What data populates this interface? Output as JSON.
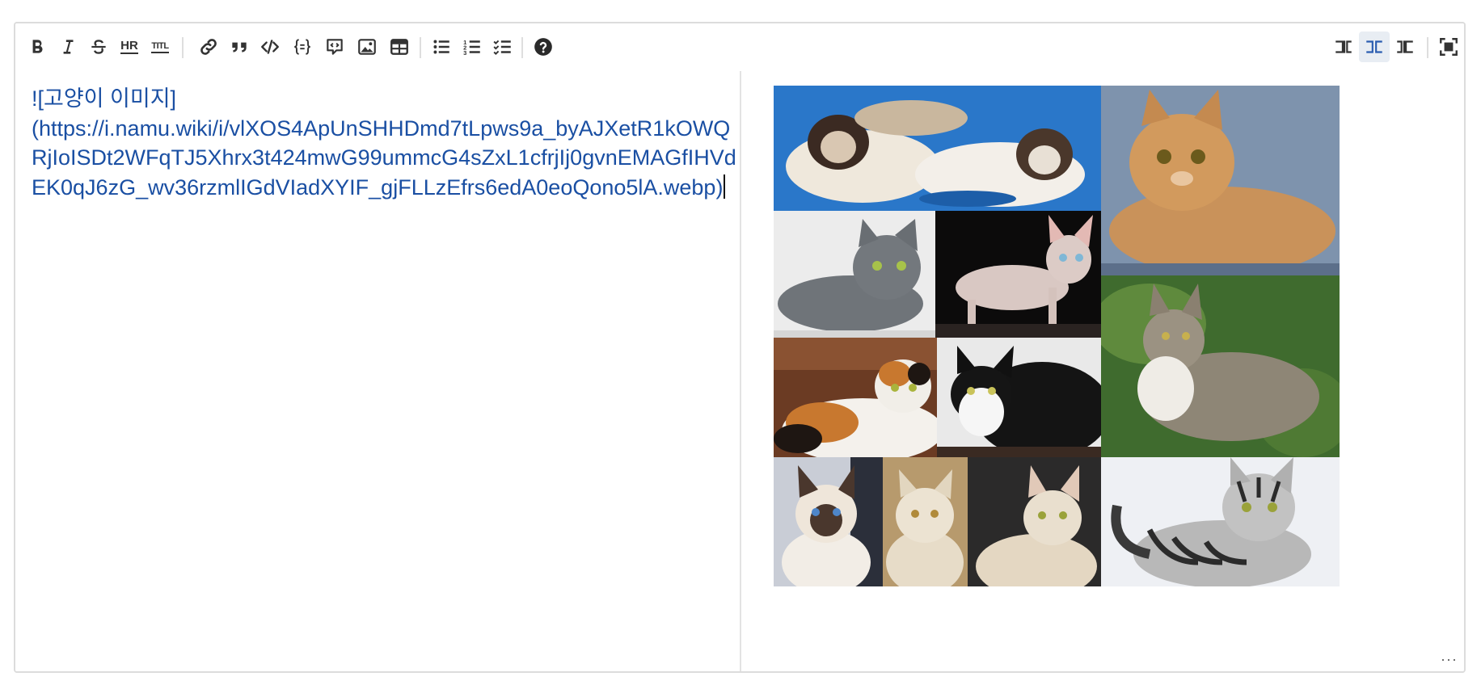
{
  "toolbar": {
    "left_buttons": [
      {
        "name": "bold-icon"
      },
      {
        "name": "italic-icon"
      },
      {
        "name": "strikethrough-icon"
      },
      {
        "name": "horizontal-rule-icon"
      },
      {
        "name": "title-icon"
      },
      {
        "name": "link-icon"
      },
      {
        "name": "quote-icon"
      },
      {
        "name": "code-icon"
      },
      {
        "name": "code-block-icon"
      },
      {
        "name": "comment-icon"
      },
      {
        "name": "image-icon"
      },
      {
        "name": "table-icon"
      },
      {
        "name": "unordered-list-icon"
      },
      {
        "name": "ordered-list-icon"
      },
      {
        "name": "task-list-icon"
      },
      {
        "name": "help-icon"
      }
    ],
    "hr_text": "HR",
    "title_text": "TITL",
    "right_buttons": [
      {
        "name": "edit-only-icon"
      },
      {
        "name": "split-view-icon",
        "active": true
      },
      {
        "name": "preview-only-icon"
      },
      {
        "name": "fullscreen-icon"
      }
    ]
  },
  "editor": {
    "markdown_line1": "![고양이 이미지]",
    "markdown_url": "(https://i.namu.wiki/i/vlXOS4ApUnSHHDmd7tLpws9a_byAJXetR1kOWQRjIoISDt2WFqTJ5Xhrx3t424mwG99ummcG4sZxL1cfrjIj0gvnEMAGfIHVdEK0qJ6zG_wv36rzmlIGdVIadXYIF_gjFLLzEfrs6edA0eoQono5lA.webp)"
  },
  "preview": {
    "image_name": "cat-collage-image"
  },
  "colors": {
    "link_text": "#1a4fa3",
    "active_toggle_bg": "#e8edf3"
  }
}
